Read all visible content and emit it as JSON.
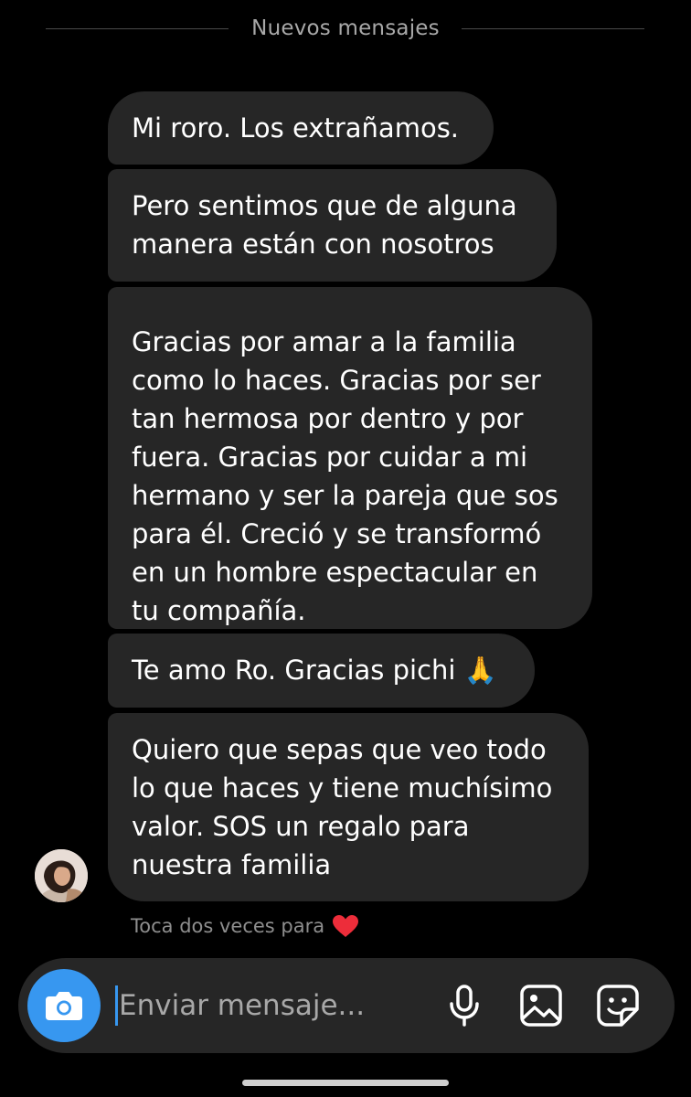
{
  "divider": {
    "label": "Nuevos mensajes"
  },
  "messages": [
    {
      "text": "Mi roro. Los extrañamos."
    },
    {
      "text": "Pero sentimos que de alguna\nmanera están con nosotros"
    },
    {
      "text": "Gracias por amar a la familia\ncomo lo haces. Gracias por ser\ntan hermosa por dentro y por\nfuera. Gracias por cuidar a mi\nhermano y ser la pareja que sos\npara él. Creció y se transformó\nen un hombre espectacular en\ntu compañía."
    },
    {
      "text": "Te amo Ro. Gracias pichi 🙏"
    },
    {
      "text": "Quiero que sepas que veo todo\nlo que haces y tiene muchísimo\nvalor. SOS un regalo para\nnuestra familia"
    }
  ],
  "hint": {
    "text": "Toca dos veces para",
    "icon": "heart-icon",
    "heart_color": "#ed2d3a"
  },
  "composer": {
    "placeholder": "Enviar mensaje...",
    "camera_icon": "camera-icon",
    "mic_icon": "microphone-icon",
    "gallery_icon": "gallery-icon",
    "sticker_icon": "sticker-icon",
    "accent_color": "#3797f0"
  }
}
